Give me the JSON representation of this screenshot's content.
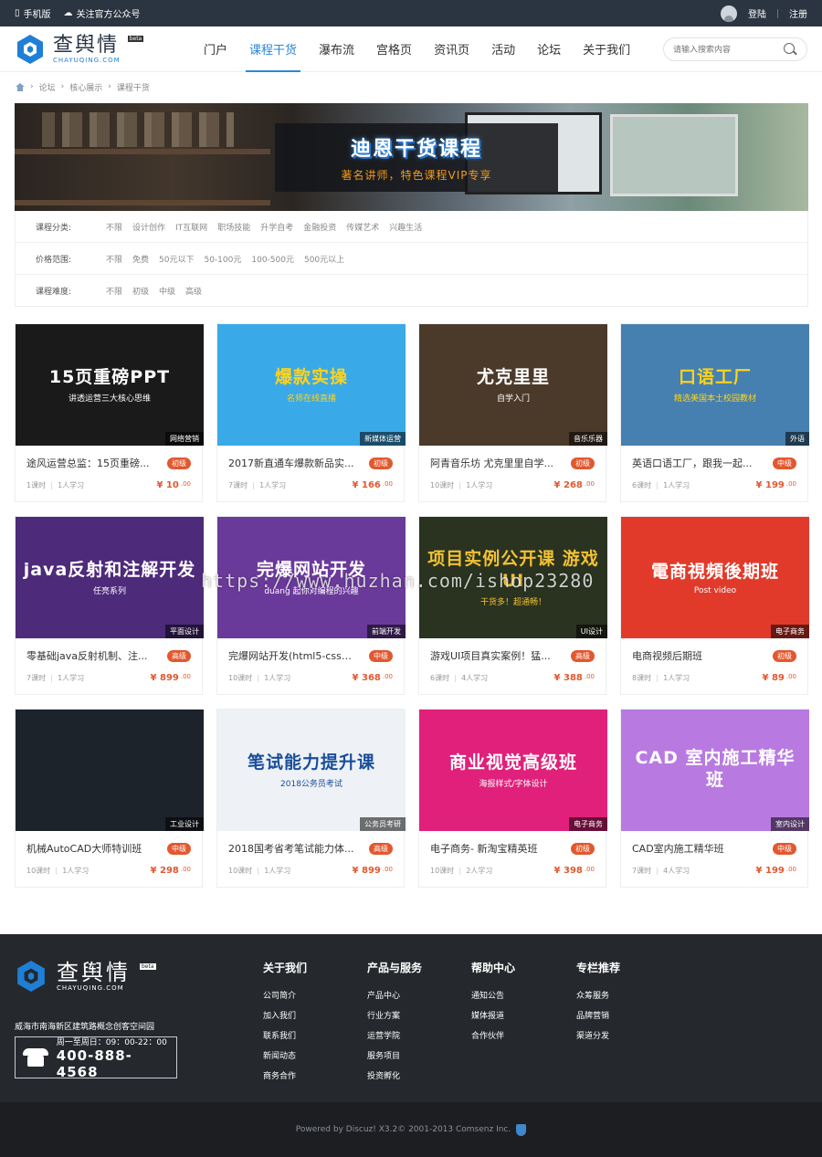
{
  "topbar": {
    "mobile": "手机版",
    "wechat": "关注官方公众号",
    "login": "登陆",
    "register": "注册"
  },
  "logo": {
    "cn": "查舆情",
    "en": "CHAYUQING.COM",
    "beta": "beta"
  },
  "nav": [
    {
      "label": "门户",
      "active": false
    },
    {
      "label": "课程干货",
      "active": true
    },
    {
      "label": "瀑布流",
      "active": false
    },
    {
      "label": "宫格页",
      "active": false
    },
    {
      "label": "资讯页",
      "active": false
    },
    {
      "label": "活动",
      "active": false
    },
    {
      "label": "论坛",
      "active": false
    },
    {
      "label": "关于我们",
      "active": false
    }
  ],
  "search": {
    "placeholder": "请输入搜索内容"
  },
  "breadcrumb": [
    "论坛",
    "核心展示",
    "课程干货"
  ],
  "banner": {
    "title": "迪恩干货课程",
    "subtitle": "著名讲师，特色课程VIP专享"
  },
  "filters": [
    {
      "label": "课程分类:",
      "options": [
        "不限",
        "设计创作",
        "IT互联网",
        "职场技能",
        "升学自考",
        "金融投资",
        "传媒艺术",
        "兴趣生活"
      ]
    },
    {
      "label": "价格范围:",
      "options": [
        "不限",
        "免费",
        "50元以下",
        "50-100元",
        "100-500元",
        "500元以上"
      ]
    },
    {
      "label": "课程难度:",
      "options": [
        "不限",
        "初级",
        "中级",
        "高级"
      ]
    }
  ],
  "courses": [
    {
      "title": "途风运营总监：15页重磅...",
      "level": "初级",
      "lessons": "1课时",
      "learners": "1人学习",
      "price": "10",
      "cents": ".00",
      "category": "网络营销",
      "thumb_title": "15页重磅PPT",
      "thumb_sub": "讲透运营三大核心思维",
      "bg": "#1a1a1a",
      "fg": "#fff"
    },
    {
      "title": "2017新直通车爆款新品实...",
      "level": "初级",
      "lessons": "7课时",
      "learners": "1人学习",
      "price": "166",
      "cents": ".00",
      "category": "新媒体运营",
      "thumb_title": "爆款实操",
      "thumb_sub": "名师在线直播",
      "bg": "#3aa9e8",
      "fg": "#ffd21a"
    },
    {
      "title": "阿青音乐坊 尤克里里自学...",
      "level": "初级",
      "lessons": "10课时",
      "learners": "1人学习",
      "price": "268",
      "cents": ".00",
      "category": "音乐乐器",
      "thumb_title": "尤克里里",
      "thumb_sub": "自学入门",
      "bg": "#4b3a2a",
      "fg": "#fff"
    },
    {
      "title": "英语口语工厂，跟我一起...",
      "level": "中级",
      "lessons": "6课时",
      "learners": "1人学习",
      "price": "199",
      "cents": ".00",
      "category": "外语",
      "thumb_title": "口语工厂",
      "thumb_sub": "精选美国本土校园教材",
      "bg": "#4680b0",
      "fg": "#ffd21a"
    },
    {
      "title": "零基础java反射机制、注...",
      "level": "高级",
      "lessons": "7课时",
      "learners": "1人学习",
      "price": "899",
      "cents": ".00",
      "category": "平面设计",
      "thumb_title": "java反射和注解开发",
      "thumb_sub": "任亮系列",
      "bg": "#4d2a7a",
      "fg": "#fff"
    },
    {
      "title": "完爆网站开发(html5-css3...",
      "level": "中级",
      "lessons": "10课时",
      "learners": "1人学习",
      "price": "368",
      "cents": ".00",
      "category": "前端开发",
      "thumb_title": "完爆网站开发",
      "thumb_sub": "duang 起你对编程的兴趣",
      "bg": "#6a3a9a",
      "fg": "#fff"
    },
    {
      "title": "游戏UI项目真实案例！猛...",
      "level": "高级",
      "lessons": "6课时",
      "learners": "4人学习",
      "price": "388",
      "cents": ".00",
      "category": "UI设计",
      "thumb_title": "项目实例公开课 游戏UI",
      "thumb_sub": "干货多！超通畅！",
      "bg": "#2a3320",
      "fg": "#f2c232"
    },
    {
      "title": "电商视频后期班",
      "level": "初级",
      "lessons": "8课时",
      "learners": "1人学习",
      "price": "89",
      "cents": ".00",
      "category": "电子商务",
      "thumb_title": "電商視頻後期班",
      "thumb_sub": "Post video",
      "bg": "#e23a2a",
      "fg": "#fff"
    },
    {
      "title": "机械AutoCAD大师特训班",
      "level": "中级",
      "lessons": "10课时",
      "learners": "1人学习",
      "price": "298",
      "cents": ".00",
      "category": "工业设计",
      "thumb_title": "",
      "thumb_sub": "",
      "bg": "#1d232a",
      "fg": "#fff"
    },
    {
      "title": "2018国考省考笔试能力体...",
      "level": "高级",
      "lessons": "10课时",
      "learners": "1人学习",
      "price": "899",
      "cents": ".00",
      "category": "公务员考研",
      "thumb_title": "笔试能力提升课",
      "thumb_sub": "2018公务员考试",
      "bg": "#eef2f6",
      "fg": "#1a4e9a"
    },
    {
      "title": "电子商务- 新淘宝精英班",
      "level": "初级",
      "lessons": "10课时",
      "learners": "2人学习",
      "price": "398",
      "cents": ".00",
      "category": "电子商务",
      "thumb_title": "商业视觉高级班",
      "thumb_sub": "海报样式/字体设计",
      "bg": "#e0207a",
      "fg": "#fff"
    },
    {
      "title": "CAD室内施工精华班",
      "level": "中级",
      "lessons": "7课时",
      "learners": "4人学习",
      "price": "199",
      "cents": ".00",
      "category": "室内设计",
      "thumb_title": "CAD 室内施工精华班",
      "thumb_sub": "",
      "bg": "#b87ae0",
      "fg": "#fff"
    }
  ],
  "footer": {
    "address": "威海市南海新区建筑路概念创客空间园",
    "hours": "周一至周日：09：00-22：00",
    "phone": "400-888-4568",
    "columns": [
      {
        "title": "关于我们",
        "links": [
          "公司简介",
          "加入我们",
          "联系我们",
          "新闻动态",
          "商务合作"
        ]
      },
      {
        "title": "产品与服务",
        "links": [
          "产品中心",
          "行业方案",
          "运营学院",
          "服务项目",
          "投资孵化"
        ]
      },
      {
        "title": "帮助中心",
        "links": [
          "通知公告",
          "媒体报道",
          "合作伙伴"
        ]
      },
      {
        "title": "专栏推荐",
        "links": [
          "众筹服务",
          "品牌营销",
          "渠道分发"
        ]
      }
    ],
    "copyright": "Powered by Discuz! X3.2© 2001-2013 Comsenz Inc."
  },
  "watermark": "https://www.huzhan.com/ishop23280",
  "colors": {
    "accent": "#2c87d6",
    "price": "#e2582f",
    "topbar": "#2b3441",
    "footer": "#25282d"
  }
}
